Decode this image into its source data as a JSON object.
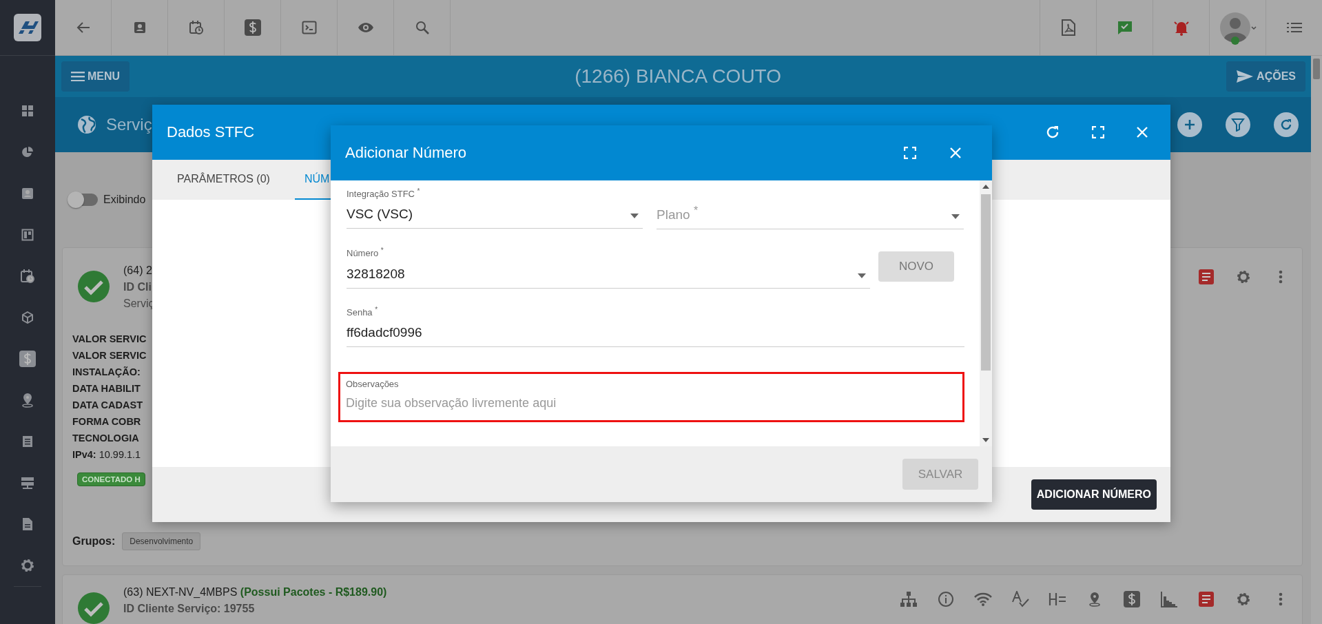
{
  "header": {
    "menu_button": "MENU",
    "title": "(1266) BIANCA COUTO",
    "actions_button": "AÇÕES"
  },
  "section": {
    "title": "Serviç"
  },
  "toggle": {
    "label": "Exibindo",
    "on": false
  },
  "cards": [
    {
      "title": "(64) 2",
      "client_id": "ID Cli",
      "subtitle": "Serviç",
      "fields": [
        "VALOR SERVIC",
        "VALOR SERVIC",
        "INSTALAÇÃO:",
        "DATA HABILIT",
        "DATA CADAST",
        "FORMA COBR",
        "TECNOLOGIA"
      ],
      "ip": "**IPv4:** 10.99.1.1",
      "status_badge": "CONECTADO H",
      "groups_label": "Grupos:",
      "groups": [
        "Desenvolvimento"
      ]
    },
    {
      "title": "(63) NEXT-NV_4MBPS **(Possui Pacotes - R$189.90)**",
      "client_id": "ID Cliente Serviço: 19755"
    }
  ],
  "dialog": {
    "title": "Dados STFC",
    "tabs": [
      {
        "label": "PARÂMETROS (0)",
        "selected": false
      },
      {
        "label": "NÚM",
        "selected": true
      }
    ],
    "footer_button": "ADICIONAR NÚMERO"
  },
  "subdialog": {
    "title": "Adicionar Número",
    "fields": [
      {
        "label": "Integração STFC $^{*}$",
        "value": "VSC (VSC)",
        "kind": "select"
      },
      {
        "label": "Plano $^{*}$",
        "kind": "select"
      },
      {
        "label": "Número $^{*}$",
        "value": "32818208",
        "kind": "select"
      },
      {
        "label": "Senha $^{*}$",
        "value": "ff6dadcf0996",
        "kind": "text"
      },
      {
        "label": "Observações",
        "placeholder": "Digite sua observação livremente aqui",
        "kind": "textarea",
        "highlighted": true
      }
    ],
    "new_button": "NOVO",
    "save_button": "SALVAR"
  }
}
